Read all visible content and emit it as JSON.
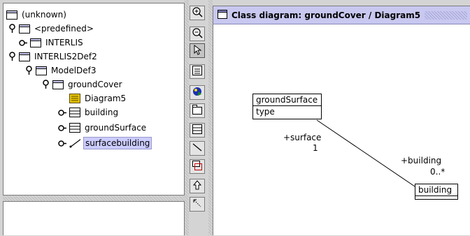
{
  "tree": {
    "root_label": "(unknown)",
    "predefined_label": "<predefined>",
    "interlis_label": "INTERLIS",
    "interlis2def2_label": "INTERLIS2Def2",
    "modeldef3_label": "ModelDef3",
    "groundcover_label": "groundCover",
    "diagram5_label": "Diagram5",
    "building_label": "building",
    "groundsurface_label": "groundSurface",
    "surfacebuilding_label": "surfacebuilding"
  },
  "palette": {
    "icons": [
      "zoom-in-icon",
      "zoom-out-icon",
      "pointer-icon",
      "text-icon",
      "pan-icon",
      "package-icon",
      "class-icon",
      "line-icon",
      "note-icon",
      "inheritance-icon",
      "dependency-icon"
    ]
  },
  "diagram": {
    "title": "Class diagram: groundCover / Diagram5",
    "class_groundsurface": {
      "name": "groundSurface",
      "attribute": "type"
    },
    "class_building": {
      "name": "building"
    },
    "role_surface": "+surface",
    "mult_surface": "1",
    "role_building": "+building",
    "mult_building": "0..*"
  },
  "colors": {
    "selection": "#ccccff",
    "titlebar": "#c8c8f0"
  }
}
